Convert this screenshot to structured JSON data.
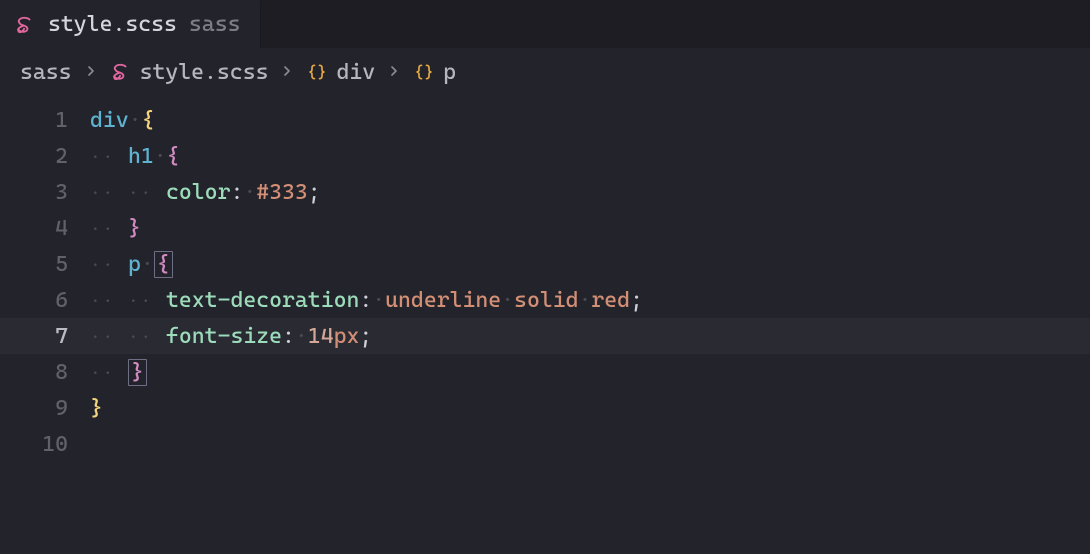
{
  "tab": {
    "filename": "style.scss",
    "lang": "sass"
  },
  "breadcrumbs": {
    "folder": "sass",
    "file": "style.scss",
    "sym1": "div",
    "sym2": "p"
  },
  "editor": {
    "current_line": 7,
    "lines": {
      "n1": "1",
      "n2": "2",
      "n3": "3",
      "n4": "4",
      "n5": "5",
      "n6": "6",
      "n7": "7",
      "n8": "8",
      "n9": "9",
      "n10": "10"
    },
    "tokens": {
      "div": "div",
      "h1": "h1",
      "p": "p",
      "lbrace": "{",
      "rbrace": "}",
      "color": "color",
      "colon": ":",
      "semi": ";",
      "hash333": "#333",
      "textdec": "text-decoration",
      "underline": "underline",
      "solid": "solid",
      "red": "red",
      "fontsize": "font-size",
      "fourteen": "14",
      "px": "px"
    }
  }
}
